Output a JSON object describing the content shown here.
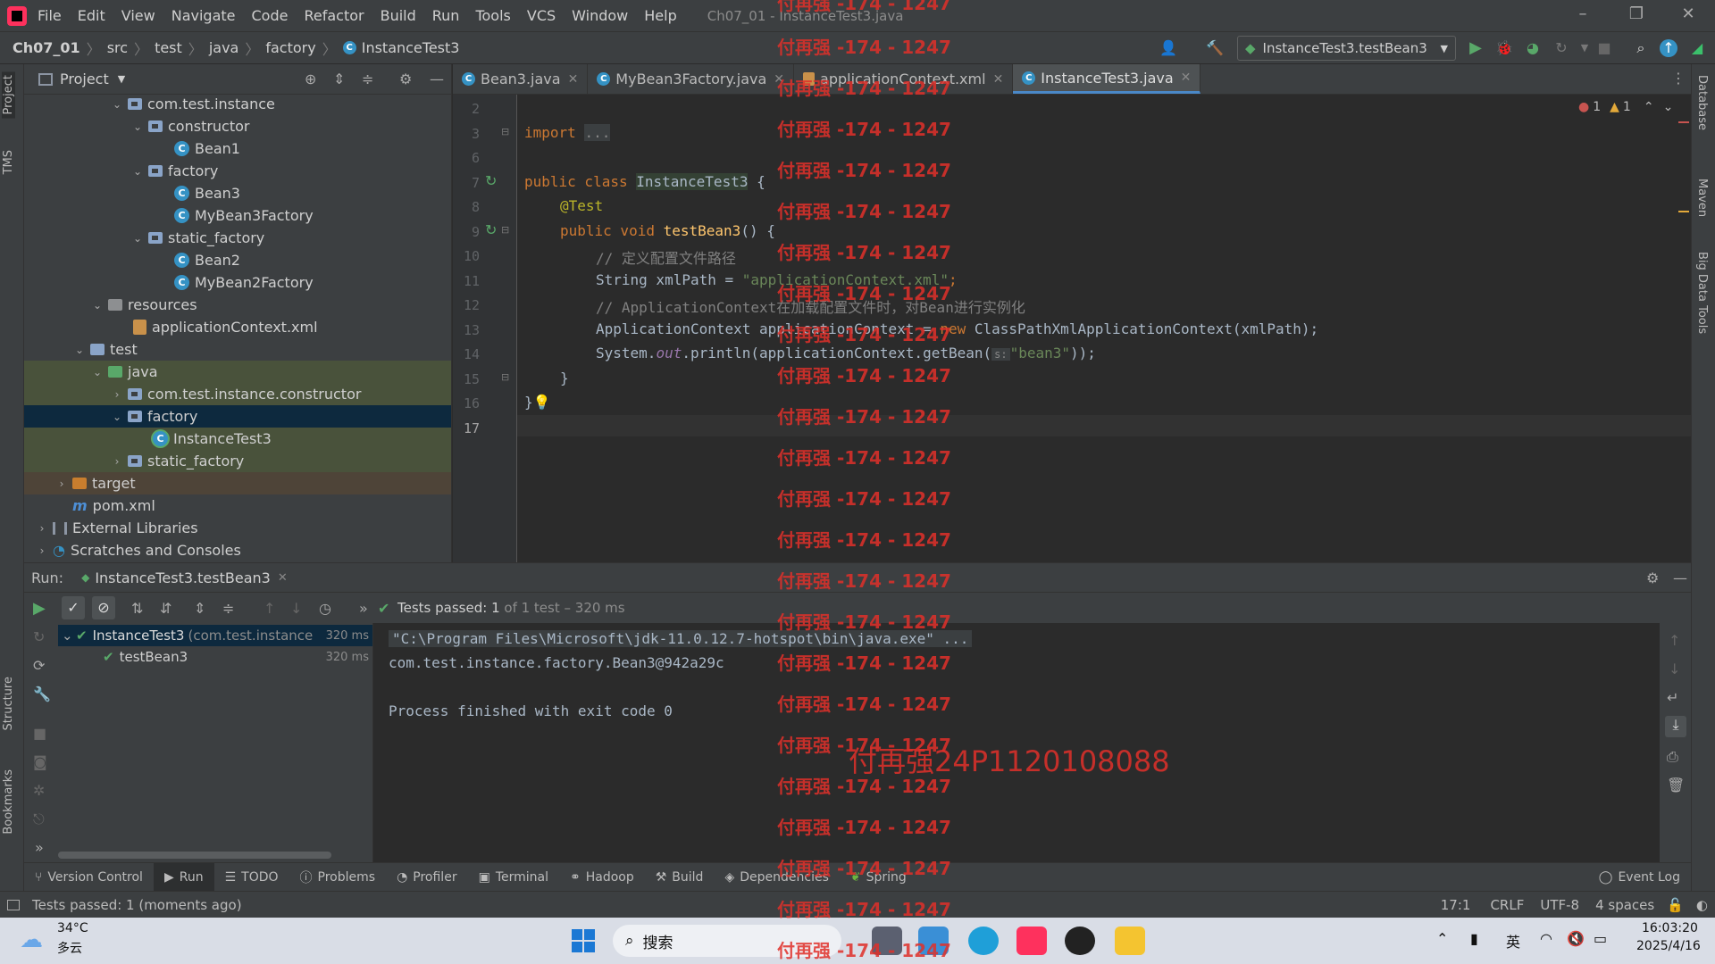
{
  "menubar": {
    "items": [
      "File",
      "Edit",
      "View",
      "Navigate",
      "Code",
      "Refactor",
      "Build",
      "Run",
      "Tools",
      "VCS",
      "Window",
      "Help"
    ],
    "title": "Ch07_01 - InstanceTest3.java"
  },
  "navbar": {
    "crumbs": [
      "Ch07_01",
      "src",
      "test",
      "java",
      "factory",
      "InstanceTest3"
    ],
    "run_config": "InstanceTest3.testBean3"
  },
  "left_strip": {
    "project": "Project",
    "tms": "TMS",
    "structure": "Structure",
    "bookmarks": "Bookmarks"
  },
  "right_strip": {
    "database": "Database",
    "maven": "Maven",
    "bigdata": "Big Data Tools"
  },
  "project": {
    "title": "Project",
    "tree": [
      {
        "label": "com.test.instance",
        "kind": "pkg"
      },
      {
        "label": "constructor",
        "kind": "pkg"
      },
      {
        "label": "Bean1",
        "kind": "class"
      },
      {
        "label": "factory",
        "kind": "pkg"
      },
      {
        "label": "Bean3",
        "kind": "class"
      },
      {
        "label": "MyBean3Factory",
        "kind": "class"
      },
      {
        "label": "static_factory",
        "kind": "pkg"
      },
      {
        "label": "Bean2",
        "kind": "class"
      },
      {
        "label": "MyBean2Factory",
        "kind": "class"
      },
      {
        "label": "resources",
        "kind": "res"
      },
      {
        "label": "applicationContext.xml",
        "kind": "xml"
      },
      {
        "label": "test",
        "kind": "dir"
      },
      {
        "label": "java",
        "kind": "dir"
      },
      {
        "label": "com.test.instance.constructor",
        "kind": "pkg"
      },
      {
        "label": "factory",
        "kind": "pkg"
      },
      {
        "label": "InstanceTest3",
        "kind": "class"
      },
      {
        "label": "static_factory",
        "kind": "pkg"
      },
      {
        "label": "target",
        "kind": "dir"
      },
      {
        "label": "pom.xml",
        "kind": "maven"
      },
      {
        "label": "External Libraries",
        "kind": "lib"
      },
      {
        "label": "Scratches and Consoles",
        "kind": "scratch"
      }
    ]
  },
  "tabs": [
    {
      "label": "Bean3.java"
    },
    {
      "label": "MyBean3Factory.java"
    },
    {
      "label": "applicationContext.xml"
    },
    {
      "label": "InstanceTest3.java"
    }
  ],
  "editor": {
    "line_numbers": [
      "2",
      "3",
      "6",
      "7",
      "8",
      "9",
      "10",
      "11",
      "12",
      "13",
      "14",
      "15",
      "16",
      "17"
    ],
    "import_kw": "import",
    "import_fold": "...",
    "public_class": "public class",
    "class_name": "InstanceTest3",
    "brace_open": " {",
    "annotation": "@Test",
    "public_void": "public void",
    "method_name": "testBean3",
    "method_tail": "() {",
    "comment1": "// 定义配置文件路径",
    "string_decl": "String xmlPath = ",
    "string_value": "\"applicationContext.xml\"",
    "semicolon": ";",
    "comment2": "// ApplicationContext在加载配置文件时，对Bean进行实例化",
    "ctx_decl": "ApplicationContext applicationContext = ",
    "new_kw": "new",
    "ctx_tail": " ClassPathXmlApplicationContext(xmlPath);",
    "println_head": "System.",
    "println_out": "out",
    "println_mid": ".println(applicationContext.getBean(",
    "param_hint": "s:",
    "println_str": "\"bean3\"",
    "println_tail": "));",
    "close_method": "}",
    "close_class": "}",
    "errors": "1",
    "warnings": "1"
  },
  "run": {
    "label": "Run:",
    "tab": "InstanceTest3.testBean3",
    "status_prefix": "Tests passed:",
    "status_count": "1",
    "status_suffix": "of 1 test – 320 ms",
    "tests": [
      {
        "name": "InstanceTest3",
        "detail": "(com.test.instance.fa",
        "time": "320 ms"
      },
      {
        "name": "testBean3",
        "detail": "",
        "time": "320 ms"
      }
    ],
    "console": [
      "\"C:\\Program Files\\Microsoft\\jdk-11.0.12.7-hotspot\\bin\\java.exe\" ...",
      "com.test.instance.factory.Bean3@942a29c",
      "",
      "Process finished with exit code 0"
    ]
  },
  "bottom_tabs": [
    "Version Control",
    "Run",
    "TODO",
    "Problems",
    "Profiler",
    "Terminal",
    "Hadoop",
    "Build",
    "Dependencies",
    "Spring"
  ],
  "event_log": "Event Log",
  "status": {
    "message": "Tests passed: 1 (moments ago)",
    "position": "17:1",
    "line_sep": "CRLF",
    "encoding": "UTF-8",
    "indent": "4 spaces"
  },
  "taskbar": {
    "temp": "34°C",
    "weather": "多云",
    "search": "搜索",
    "ime": "英",
    "time": "16:03:20",
    "date": "2025/4/16"
  },
  "watermark": {
    "line": "付再强 -174 - 1247",
    "id": "付再强24P1120108088"
  },
  "colors": {
    "accent": "#4a88c7",
    "run_green": "#59a869",
    "watermark": "#e0302a"
  }
}
